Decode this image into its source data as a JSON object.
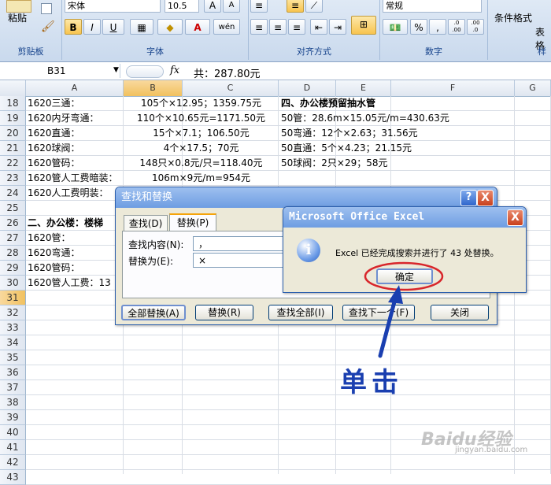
{
  "ribbon": {
    "paste_label": "粘贴",
    "font_name": "宋体",
    "font_size": "10.5",
    "bold": "B",
    "italic": "I",
    "underline": "U",
    "font_color_glyph": "A",
    "phonetic_glyph": "wén",
    "percent": "%",
    "comma": ",",
    "dec_inc": ".0 .00",
    "dec_dec": ".00 .0",
    "number_format": "常规",
    "cond_format": "条件格式",
    "table_format": "表格",
    "groups": {
      "clipboard": "剪贴板",
      "font": "字体",
      "alignment": "对齐方式",
      "number": "数字",
      "styles": "样"
    }
  },
  "formula_bar": {
    "cell_ref": "B31",
    "fx": "fx",
    "content": "共：287.80元"
  },
  "columns": [
    "A",
    "B",
    "C",
    "D",
    "E",
    "F",
    "G"
  ],
  "selected_column": "B",
  "rows": [
    {
      "n": "18",
      "a": "1620三通：",
      "bc": "105个×12.95；1359.75元",
      "d": "四、办公楼预留抽水管",
      "d_bold": true
    },
    {
      "n": "19",
      "a": "1620内牙弯通：",
      "bc": "110个×10.65元=1171.50元",
      "d": "50管：28.6m×15.05元/m=430.63元"
    },
    {
      "n": "20",
      "a": "1620直通：",
      "bc": "15个×7.1；106.50元",
      "d": "50弯通：12个×2.63；31.56元"
    },
    {
      "n": "21",
      "a": "1620球阀：",
      "bc": "4个×17.5；70元",
      "d": "50直通：5个×4.23；21.15元"
    },
    {
      "n": "22",
      "a": "1620管码：",
      "bc": "148只×0.8元/只=118.40元",
      "d": "50球阀：2只×29；58元"
    },
    {
      "n": "23",
      "a": "1620管人工费暗装：",
      "bc": "106m×9元/m=954元",
      "d": ""
    },
    {
      "n": "24",
      "a": "1620人工费明装：",
      "bc": "",
      "d": ""
    },
    {
      "n": "25",
      "a": "",
      "bc": "",
      "d": ""
    },
    {
      "n": "26",
      "a": "二、办公楼：楼梯",
      "a_bold": true,
      "bc": "",
      "d": ""
    },
    {
      "n": "27",
      "a": "1620管：",
      "bc": "",
      "d": ""
    },
    {
      "n": "28",
      "a": "1620弯通：",
      "bc": "",
      "d": ""
    },
    {
      "n": "29",
      "a": "1620管码：",
      "bc": "",
      "d": ""
    },
    {
      "n": "30",
      "a": "1620管人工费：13",
      "bc": "",
      "d": ""
    },
    {
      "n": "31",
      "a": "",
      "bc": "",
      "d": ""
    },
    {
      "n": "32"
    },
    {
      "n": "33"
    },
    {
      "n": "34"
    },
    {
      "n": "35"
    },
    {
      "n": "36"
    },
    {
      "n": "37"
    },
    {
      "n": "38"
    },
    {
      "n": "39"
    },
    {
      "n": "40"
    },
    {
      "n": "41"
    },
    {
      "n": "42"
    },
    {
      "n": "43"
    }
  ],
  "find_dialog": {
    "title": "查找和替换",
    "help": "?",
    "close": "X",
    "tab_find": "查找(D)",
    "tab_replace": "替换(P)",
    "find_label": "查找内容(N):",
    "find_value": "，",
    "replace_label": "替换为(E):",
    "replace_value": "×",
    "btn_replace_all": "全部替换(A)",
    "btn_replace": "替换(R)",
    "btn_find_all": "查找全部(I)",
    "btn_find_next": "查找下一个(F)",
    "btn_close": "关闭"
  },
  "msg_dialog": {
    "title": "Microsoft Office Excel",
    "close": "X",
    "info_glyph": "i",
    "message": "Excel 已经完成搜索并进行了 43 处替换。",
    "ok": "确定"
  },
  "annotation": {
    "text": "单击",
    "color": "#1a3fb0",
    "circle_color": "#d8262b"
  },
  "watermark": {
    "text": "Baidu经验",
    "url": "jingyan.baidu.com"
  }
}
